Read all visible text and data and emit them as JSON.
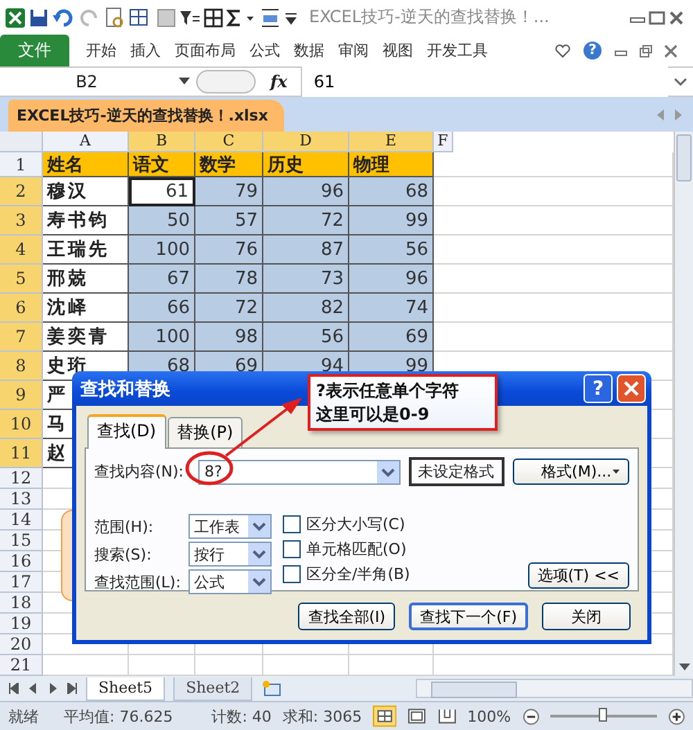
{
  "title_bar": {
    "title": "EXCEL技巧-逆天的查找替换！..."
  },
  "ribbon": {
    "help": "?",
    "file_tab": "文件",
    "tabs": [
      "开始",
      "插入",
      "页面布局",
      "公式",
      "数据",
      "审阅",
      "视图",
      "开发工具"
    ]
  },
  "formula_bar": {
    "name_box": "B2",
    "function_label": "fx",
    "formula": "61"
  },
  "workbook_tab": "EXCEL技巧-逆天的查找替换！.xlsx",
  "columns": [
    {
      "label": "A",
      "selected": false
    },
    {
      "label": "B",
      "selected": true
    },
    {
      "label": "C",
      "selected": true
    },
    {
      "label": "D",
      "selected": true
    },
    {
      "label": "E",
      "selected": true
    },
    {
      "label": "F",
      "selected": false
    }
  ],
  "rows": [
    {
      "number": "1",
      "kind": "header",
      "selected": false,
      "cells": [
        "姓名",
        "语文",
        "数学",
        "历史",
        "物理"
      ]
    },
    {
      "number": "2",
      "kind": "data",
      "selected": true,
      "active": true,
      "cells": [
        "穆汉",
        "61",
        "79",
        "96",
        "68"
      ]
    },
    {
      "number": "3",
      "kind": "data",
      "selected": true,
      "active": false,
      "cells": [
        "寿书钧",
        "50",
        "57",
        "72",
        "99"
      ]
    },
    {
      "number": "4",
      "kind": "data",
      "selected": true,
      "active": false,
      "cells": [
        "王瑞先",
        "100",
        "76",
        "87",
        "56"
      ]
    },
    {
      "number": "5",
      "kind": "data",
      "selected": true,
      "active": false,
      "cells": [
        "邢兢",
        "67",
        "78",
        "73",
        "96"
      ]
    },
    {
      "number": "6",
      "kind": "data",
      "selected": true,
      "active": false,
      "cells": [
        "沈峄",
        "66",
        "72",
        "82",
        "74"
      ]
    },
    {
      "number": "7",
      "kind": "data",
      "selected": true,
      "active": false,
      "cells": [
        "姜奕青",
        "100",
        "98",
        "56",
        "69"
      ]
    },
    {
      "number": "8",
      "kind": "data",
      "selected": true,
      "active": false,
      "cells": [
        "史珩",
        "68",
        "69",
        "94",
        "99"
      ]
    },
    {
      "number": "9",
      "kind": "data",
      "selected": true,
      "cells": [
        "严"
      ]
    },
    {
      "number": "10",
      "kind": "data",
      "selected": true,
      "cells": [
        "马"
      ]
    },
    {
      "number": "11",
      "kind": "data",
      "selected": true,
      "cells": [
        "赵"
      ]
    },
    {
      "number": "12",
      "kind": "empty",
      "selected": false
    },
    {
      "number": "13",
      "kind": "empty",
      "selected": false
    },
    {
      "number": "14",
      "kind": "empty",
      "selected": false
    },
    {
      "number": "15",
      "kind": "empty",
      "selected": false
    },
    {
      "number": "16",
      "kind": "empty",
      "selected": false
    },
    {
      "number": "17",
      "kind": "empty",
      "selected": false
    },
    {
      "number": "18",
      "kind": "empty",
      "selected": false
    },
    {
      "number": "19",
      "kind": "empty",
      "selected": false
    },
    {
      "number": "20",
      "kind": "empty",
      "selected": false
    },
    {
      "number": "21",
      "kind": "empty",
      "selected": false
    }
  ],
  "sheet_tabs": [
    {
      "label": "Sheet5",
      "selected": true
    },
    {
      "label": "Sheet2",
      "selected": false
    }
  ],
  "status_bar": {
    "ready": "就绪",
    "average": "平均值: 76.625",
    "count": "计数: 40",
    "sum": "求和: 3065",
    "zoom": "100%",
    "zoom_slider": {
      "level": 0.5
    }
  },
  "dialog": {
    "title": "查找和替换",
    "help": "?",
    "tabs": [
      {
        "label": "查找(D)",
        "selected": true
      },
      {
        "label": "替换(P)",
        "selected": false
      }
    ],
    "find_label": "查找内容(N):",
    "find_value": "8?",
    "format_status": "未设定格式",
    "format_button": "格式(M)...",
    "selects": [
      {
        "label": "范围(H):",
        "value": "工作表"
      },
      {
        "label": "搜索(S):",
        "value": "按行"
      },
      {
        "label": "查找范围(L):",
        "value": "公式"
      }
    ],
    "checkboxes": [
      {
        "label": "区分大小写(C)",
        "checked": false
      },
      {
        "label": "单元格匹配(O)",
        "checked": false
      },
      {
        "label": "区分全/半角(B)",
        "checked": false
      }
    ],
    "options_button": "选项(T) <<",
    "buttons": [
      {
        "label": "查找全部(I)",
        "default": false
      },
      {
        "label": "查找下一个(F)",
        "default": true
      },
      {
        "label": "关闭",
        "default": false
      }
    ]
  },
  "callout": {
    "lines": [
      "?表示任意单个字符",
      "这里可以是0-9"
    ]
  }
}
